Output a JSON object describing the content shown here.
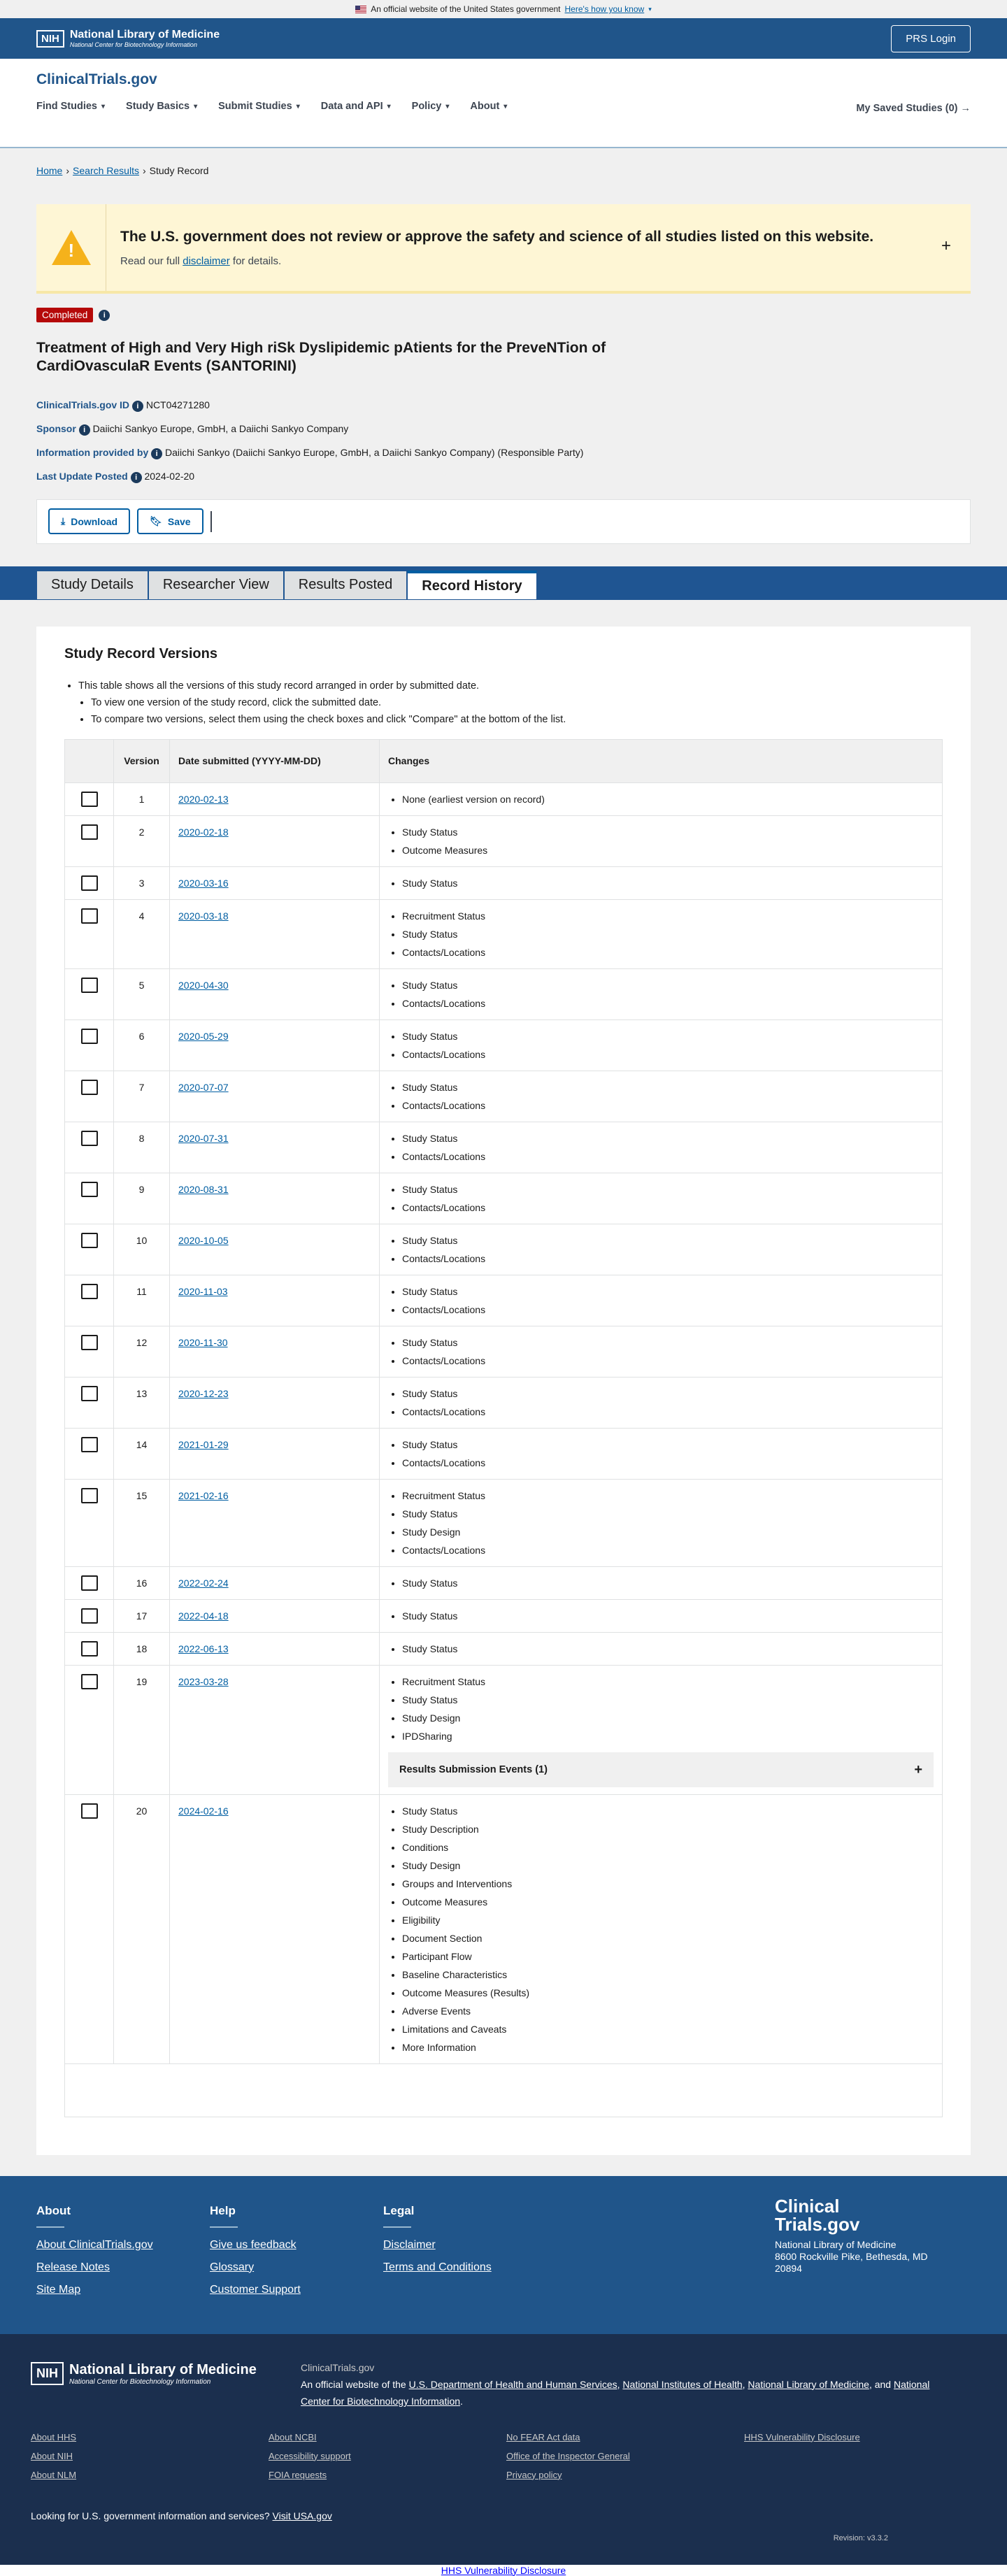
{
  "gov_banner": {
    "text": "An official website of the United States government",
    "link": "Here's how you know"
  },
  "nlm": {
    "nih": "NIH",
    "name": "National Library of Medicine",
    "sub": "National Center for Biotechnology Information",
    "prs_login": "PRS Login"
  },
  "site": {
    "brand": "ClinicalTrials.gov",
    "nav": [
      "Find Studies",
      "Study Basics",
      "Submit Studies",
      "Data and API",
      "Policy",
      "About"
    ],
    "saved": "My Saved Studies (0)"
  },
  "breadcrumb": {
    "home": "Home",
    "search": "Search Results",
    "current": "Study Record"
  },
  "disclaimer": {
    "heading": "The U.S. government does not review or approve the safety and science of all studies listed on this website.",
    "pre": "Read our full",
    "link": "disclaimer",
    "post": "for details."
  },
  "study": {
    "status": "Completed",
    "title": "Treatment of High and Very High riSk Dyslipidemic pAtients for the PreveNTion of CardiOvasculaR Events (SANTORINI)",
    "id_label": "ClinicalTrials.gov ID",
    "id": "NCT04271280",
    "sponsor_label": "Sponsor",
    "sponsor": "Daiichi Sankyo Europe, GmbH, a Daiichi Sankyo Company",
    "info_label": "Information provided by",
    "info": "Daiichi Sankyo (Daiichi Sankyo Europe, GmbH, a Daiichi Sankyo Company) (Responsible Party)",
    "updated_label": "Last Update Posted",
    "updated": "2024-02-20"
  },
  "actions": {
    "download": "Download",
    "save": "Save"
  },
  "tabs": [
    "Study Details",
    "Researcher View",
    "Results Posted",
    "Record History"
  ],
  "versions": {
    "heading": "Study Record Versions",
    "intro": "This table shows all the versions of this study record arranged in order by submitted date.",
    "bullet1": "To view one version of the study record, click the submitted date.",
    "bullet2": "To compare two versions, select them using the check boxes and click \"Compare\" at the bottom of the list.",
    "col_version": "Version",
    "col_date": "Date submitted (YYYY-MM-DD)",
    "col_changes": "Changes",
    "rse": "Results Submission Events (1)",
    "rows": [
      {
        "v": "1",
        "d": "2020-02-13",
        "c": [
          "None (earliest version on record)"
        ]
      },
      {
        "v": "2",
        "d": "2020-02-18",
        "c": [
          "Study Status",
          "Outcome Measures"
        ]
      },
      {
        "v": "3",
        "d": "2020-03-16",
        "c": [
          "Study Status"
        ]
      },
      {
        "v": "4",
        "d": "2020-03-18",
        "c": [
          "Recruitment Status",
          "Study Status",
          "Contacts/Locations"
        ]
      },
      {
        "v": "5",
        "d": "2020-04-30",
        "c": [
          "Study Status",
          "Contacts/Locations"
        ]
      },
      {
        "v": "6",
        "d": "2020-05-29",
        "c": [
          "Study Status",
          "Contacts/Locations"
        ]
      },
      {
        "v": "7",
        "d": "2020-07-07",
        "c": [
          "Study Status",
          "Contacts/Locations"
        ]
      },
      {
        "v": "8",
        "d": "2020-07-31",
        "c": [
          "Study Status",
          "Contacts/Locations"
        ]
      },
      {
        "v": "9",
        "d": "2020-08-31",
        "c": [
          "Study Status",
          "Contacts/Locations"
        ]
      },
      {
        "v": "10",
        "d": "2020-10-05",
        "c": [
          "Study Status",
          "Contacts/Locations"
        ]
      },
      {
        "v": "11",
        "d": "2020-11-03",
        "c": [
          "Study Status",
          "Contacts/Locations"
        ]
      },
      {
        "v": "12",
        "d": "2020-11-30",
        "c": [
          "Study Status",
          "Contacts/Locations"
        ]
      },
      {
        "v": "13",
        "d": "2020-12-23",
        "c": [
          "Study Status",
          "Contacts/Locations"
        ]
      },
      {
        "v": "14",
        "d": "2021-01-29",
        "c": [
          "Study Status",
          "Contacts/Locations"
        ]
      },
      {
        "v": "15",
        "d": "2021-02-16",
        "c": [
          "Recruitment Status",
          "Study Status",
          "Study Design",
          "Contacts/Locations"
        ]
      },
      {
        "v": "16",
        "d": "2022-02-24",
        "c": [
          "Study Status"
        ]
      },
      {
        "v": "17",
        "d": "2022-04-18",
        "c": [
          "Study Status"
        ]
      },
      {
        "v": "18",
        "d": "2022-06-13",
        "c": [
          "Study Status"
        ]
      },
      {
        "v": "19",
        "d": "2023-03-28",
        "c": [
          "Recruitment Status",
          "Study Status",
          "Study Design",
          "IPDSharing"
        ],
        "rse": true
      },
      {
        "v": "20",
        "d": "2024-02-16",
        "c": [
          "Study Status",
          "Study Description",
          "Conditions",
          "Study Design",
          "Groups and Interventions",
          "Outcome Measures",
          "Eligibility",
          "Document Section",
          "Participant Flow",
          "Baseline Characteristics",
          "Outcome Measures (Results)",
          "Adverse Events",
          "Limitations and Caveats",
          "More Information"
        ]
      }
    ]
  },
  "footer": {
    "about_h": "About",
    "about": [
      "About ClinicalTrials.gov",
      "Release Notes",
      "Site Map"
    ],
    "help_h": "Help",
    "help": [
      "Give us feedback",
      "Glossary",
      "Customer Support"
    ],
    "legal_h": "Legal",
    "legal": [
      "Disclaimer",
      "Terms and Conditions"
    ],
    "logo1": "Clinical",
    "logo2": "Trials.gov",
    "org": "National Library of Medicine",
    "addr": "8600 Rockville Pike, Bethesda, MD 20894"
  },
  "nlm_footer": {
    "ct": "ClinicalTrials.gov",
    "official_pre": "An official website of the",
    "l1": "U.S. Department of Health and Human Services",
    "l2": "National Institutes of Health",
    "l3": "National Library of Medicine",
    "and": "and",
    "l4": "National Center for Biotechnology Information",
    "links": [
      "About HHS",
      "About NCBI",
      "No FEAR Act data",
      "HHS Vulnerability Disclosure",
      "About NIH",
      "Accessibility support",
      "Office of the Inspector General",
      "",
      "About NLM",
      "FOIA requests",
      "Privacy policy",
      ""
    ],
    "lookup": "Looking for U.S. government information and services?",
    "usa": "Visit USA.gov",
    "revision": "Revision: v3.3.2",
    "bottom": "HHS Vulnerability Disclosure"
  }
}
